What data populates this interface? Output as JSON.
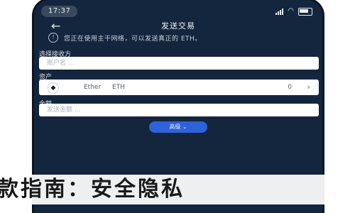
{
  "status": {
    "time": "17:37"
  },
  "nav": {
    "title": "发送交易"
  },
  "notice": {
    "text": "您正在使用主干网络，可以发送真正的 ETH。"
  },
  "form": {
    "account_label": "选择接收方",
    "account_placeholder": "账户名 ...",
    "asset_label": "资产",
    "asset_name": "Ether",
    "asset_symbol": "ETH",
    "asset_balance": "0",
    "amount_label": "金额",
    "amount_placeholder": "发送金额 ..."
  },
  "advanced": {
    "label": "高级 ⌄"
  },
  "banner": {
    "text": "款指南：安全隐私"
  },
  "colors": {
    "background": "#14263d",
    "accent": "#2e63d8",
    "field": "#ffffff"
  },
  "icons": {
    "back": "back-arrow-icon",
    "info": "info-icon",
    "coin": "ethereum-icon",
    "chevron": "chevron-right-icon"
  }
}
